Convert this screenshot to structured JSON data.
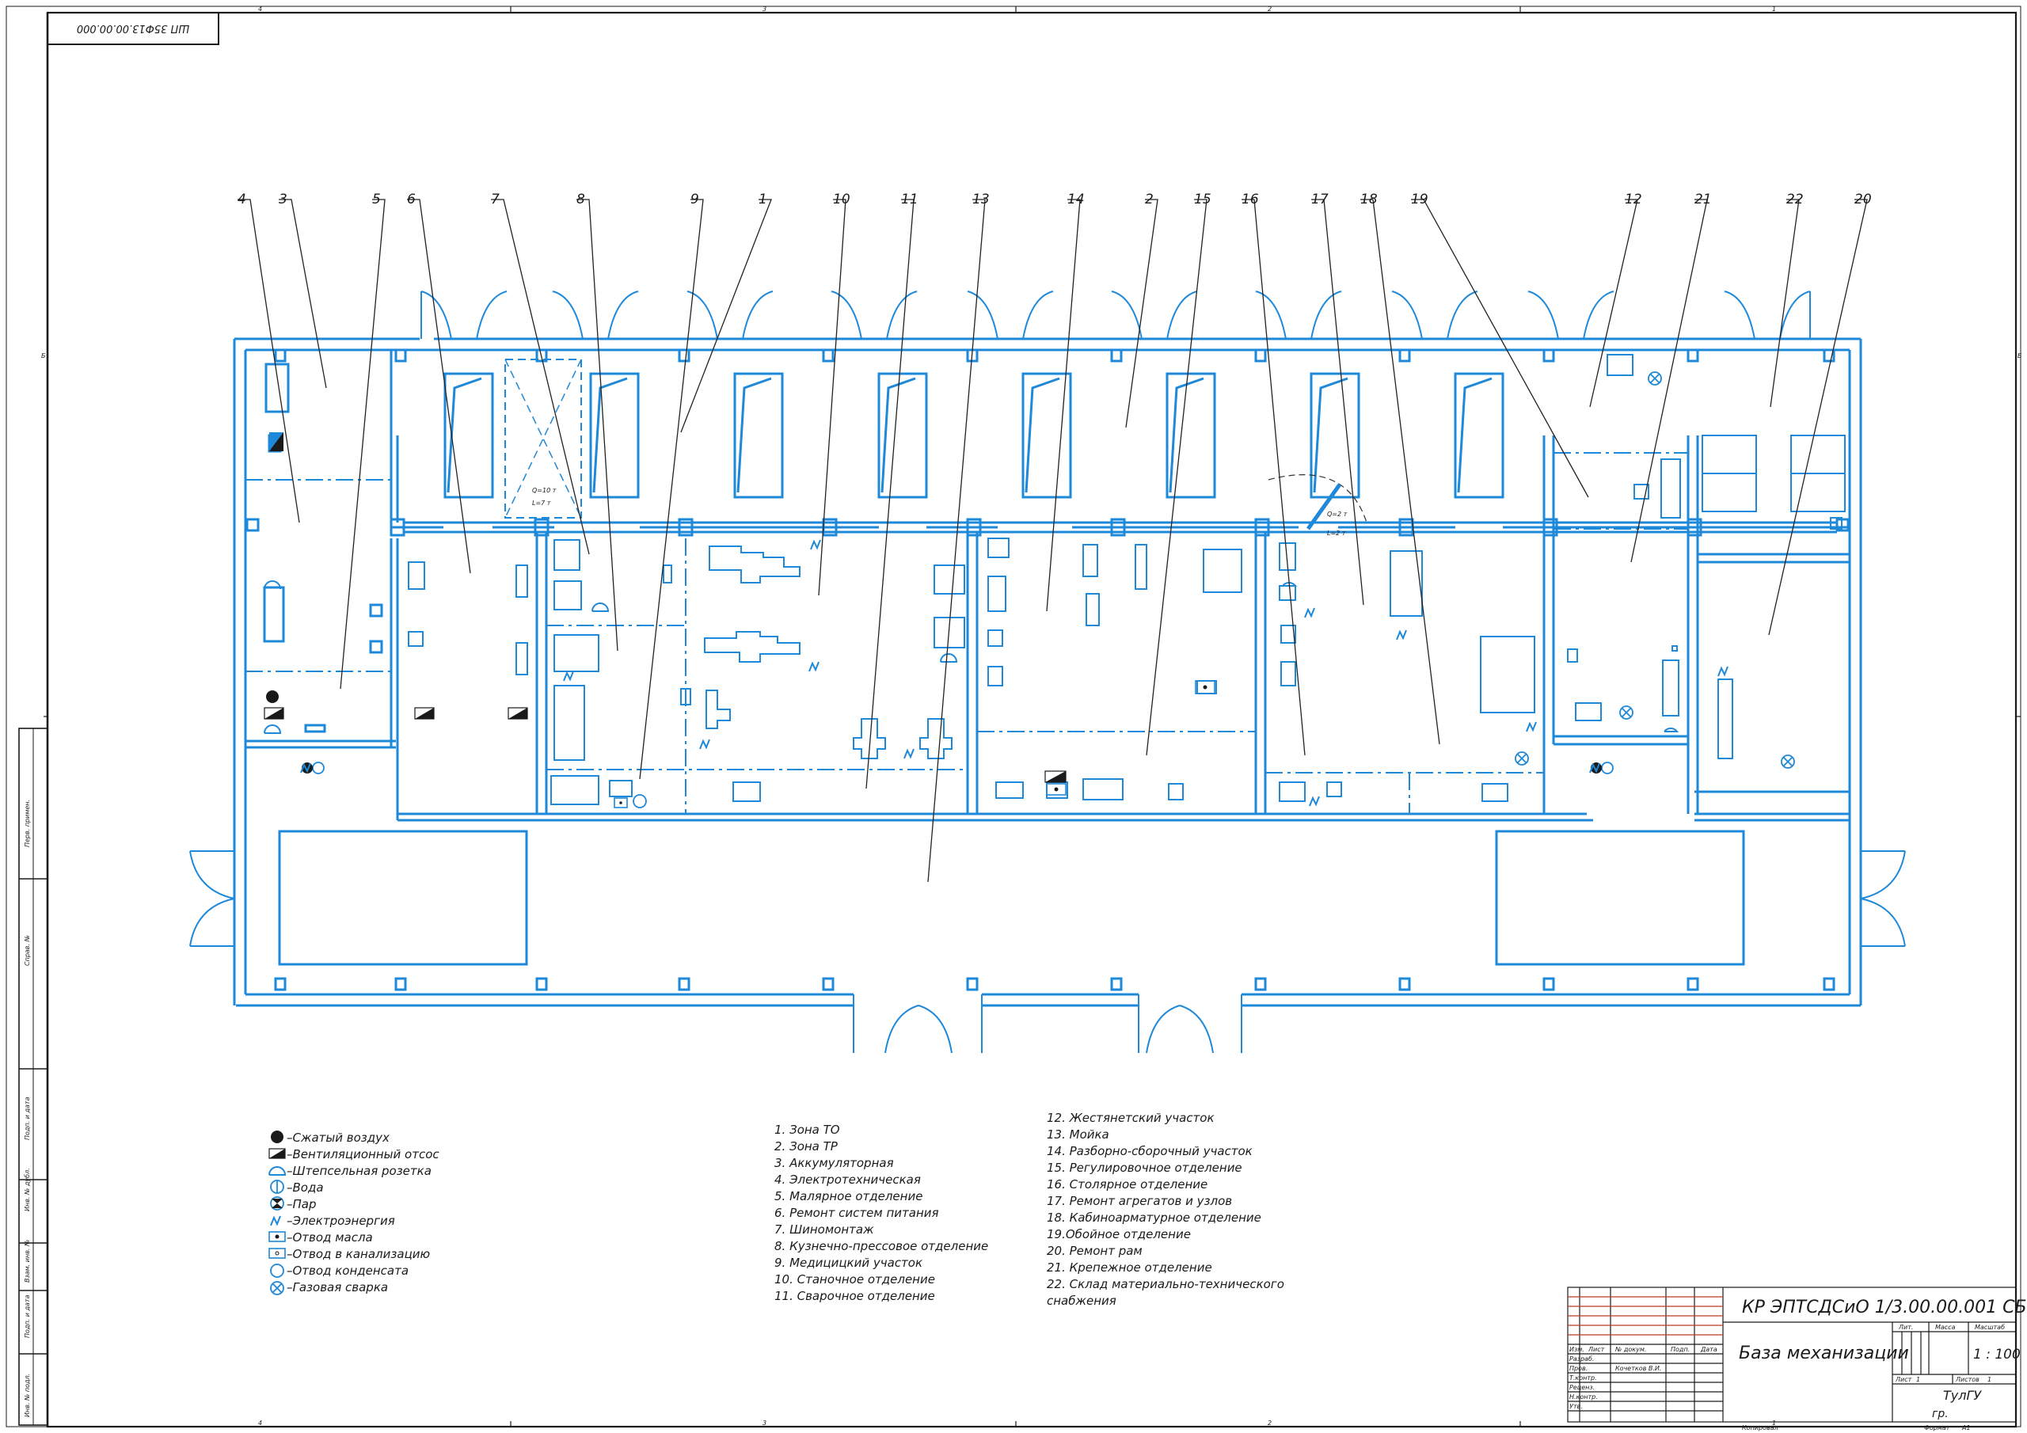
{
  "sheet": {
    "stamp_code": "ШП 35Ф13.00.00.000",
    "zone_numbers_top": [
      "4",
      "3",
      "2",
      "1"
    ],
    "zone_numbers_bottom": [
      "4",
      "3",
      "2",
      "1"
    ],
    "side_letters": [
      "Б",
      "Б"
    ],
    "side_labels": [
      "Перв. примен.",
      "Справ. №",
      "Подп. и дата",
      "Инв. № дубл.",
      "Взам. инв. №",
      "Подп. и дата",
      "Инв. № подл."
    ]
  },
  "plan": {
    "callouts": [
      "4",
      "3",
      "5",
      "6",
      "7",
      "8",
      "9",
      "1",
      "10",
      "11",
      "13",
      "14",
      "2",
      "15",
      "16",
      "17",
      "18",
      "19",
      "12",
      "21",
      "22",
      "20"
    ],
    "dims": [
      "Q=10 т",
      "L=7 т",
      "Q=2 т",
      "L=2 т"
    ]
  },
  "legend": {
    "items": [
      {
        "icon": "compressed-air-icon",
        "text": "–Сжатый воздух"
      },
      {
        "icon": "ventilation-exhaust-icon",
        "text": "–Вентиляционный отсос"
      },
      {
        "icon": "socket-outlet-icon",
        "text": "–Штепсельная розетка"
      },
      {
        "icon": "water-icon",
        "text": "–Вода"
      },
      {
        "icon": "steam-icon",
        "text": "–Пар"
      },
      {
        "icon": "electric-power-icon",
        "text": "–Электроэнергия"
      },
      {
        "icon": "oil-drain-icon",
        "text": "–Отвод масла"
      },
      {
        "icon": "sewer-drain-icon",
        "text": "–Отвод в канализацию"
      },
      {
        "icon": "condensate-drain-icon",
        "text": "–Отвод конденсата"
      },
      {
        "icon": "gas-welding-icon",
        "text": "–Газовая сварка"
      }
    ]
  },
  "zones_a": [
    "1. Зона ТО",
    "2. Зона ТР",
    "3. Аккумуляторная",
    "4. Электротехническая",
    "5. Малярное отделение",
    "6. Ремонт систем питания",
    "7. Шиномонтаж",
    "8. Кузнечно-прессовое отделение",
    "9. Медицицкий участок",
    "10. Станочное отделение",
    "11. Сварочное отделение"
  ],
  "zones_b": [
    "12. Жестянетский участок",
    "13. Мойка",
    "14. Разборно-сборочный участок",
    "15. Регулировочное отделение",
    "16. Столярное отделение",
    "17. Ремонт агрегатов и узлов",
    "18. Кабиноарматурное отделение",
    "19.Обойное отделение",
    "20. Ремонт рам",
    "21. Крепежное отделение",
    "22. Склад материально-технического",
    "снабжения"
  ],
  "title_block": {
    "designation": "КР ЭПТСДСиО 1/3.00.00.001 СБ",
    "name": "База механизации",
    "scale": "1 : 100",
    "organization": "ТулГУ",
    "group": "гр.",
    "col_lit": "Лит.",
    "col_mass": "Масса",
    "col_scale": "Масштаб",
    "sheet_label": "Лист",
    "sheets_label": "Листов",
    "sheet_no": "1",
    "sheets_no": "1",
    "rows": [
      "Изм.",
      "Разраб.",
      "Пров.",
      "Т.контр.",
      "Реценз.",
      "Н.контр.",
      "Утв."
    ],
    "hdr_cols": [
      "Изм.",
      "Лист",
      "№ докум.",
      "Подп.",
      "Дата"
    ],
    "checker": "Кочетков В.И.",
    "copied": "Копировал",
    "format": "Формат",
    "format_value": "А1"
  }
}
